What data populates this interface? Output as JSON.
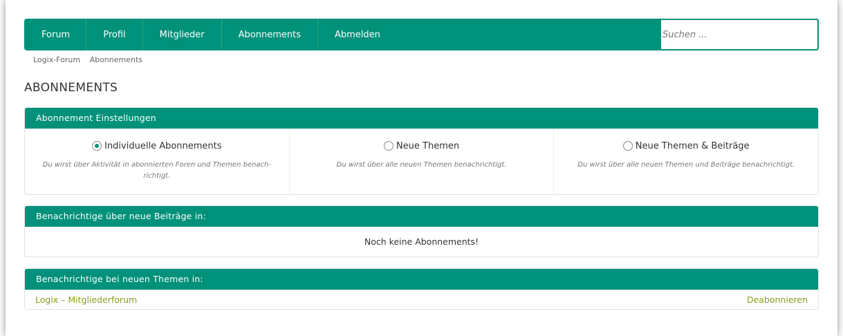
{
  "nav": {
    "items": [
      {
        "label": "Forum"
      },
      {
        "label": "Profil"
      },
      {
        "label": "Mitglieder"
      },
      {
        "label": "Abonnements"
      },
      {
        "label": "Abmelden"
      }
    ],
    "search_placeholder": "Suchen ..."
  },
  "breadcrumb": [
    "Logix-Forum",
    "Abonnements"
  ],
  "page_title": "ABONNEMENTS",
  "settings": {
    "header": "Abonnement Einstellungen",
    "options": [
      {
        "label": "Individuelle Abonnements",
        "desc": "Du wirst über Aktivität in abonnierten Foren und Themen benach-richtigt.",
        "checked": true
      },
      {
        "label": "Neue Themen",
        "desc": "Du wirst über alle neuen Themen benachrichtigt.",
        "checked": false
      },
      {
        "label": "Neue Themen & Beiträge",
        "desc": "Du wirst über alle neuen Themen und Beiträge benachrichtigt.",
        "checked": false
      }
    ]
  },
  "posts": {
    "header": "Benachrichtige über neue Beiträge in:",
    "empty": "Noch keine Abonnements!"
  },
  "topics": {
    "header": "Benachrichtige bei neuen Themen in:",
    "items": [
      {
        "name": "Logix – Mitgliederforum",
        "action": "Deabonnieren"
      }
    ]
  },
  "colors": {
    "accent": "#00917a",
    "link": "#8c9a1f"
  }
}
